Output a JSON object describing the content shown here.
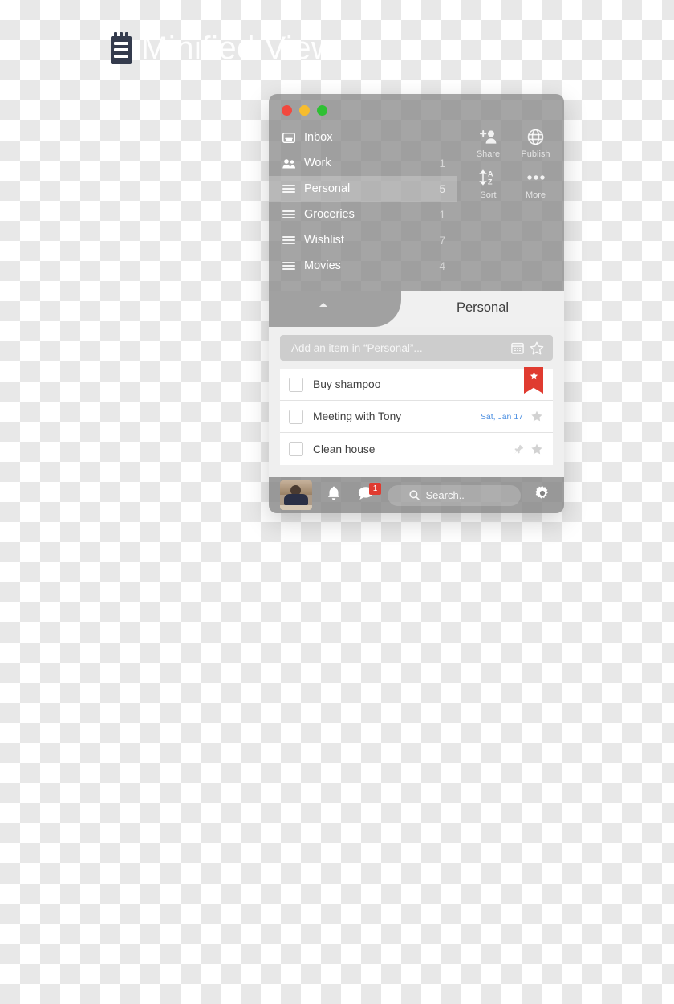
{
  "watermark": {
    "text": "Minified View",
    "logo_icon": "notepad-icon"
  },
  "window": {
    "traffic_lights": [
      {
        "name": "close",
        "color": "#f2483e"
      },
      {
        "name": "minimize",
        "color": "#f7bd2e"
      },
      {
        "name": "zoom",
        "color": "#2ec033"
      }
    ]
  },
  "sidebar": {
    "items": [
      {
        "label": "Inbox",
        "count": "",
        "icon": "inbox-icon",
        "selected": false
      },
      {
        "label": "Work",
        "count": "1",
        "icon": "people-icon",
        "selected": false
      },
      {
        "label": "Personal",
        "count": "5",
        "icon": "hamburger-icon",
        "selected": true
      },
      {
        "label": "Groceries",
        "count": "1",
        "icon": "hamburger-icon",
        "selected": false
      },
      {
        "label": "Wishlist",
        "count": "7",
        "icon": "hamburger-icon",
        "selected": false
      },
      {
        "label": "Movies",
        "count": "4",
        "icon": "hamburger-icon",
        "selected": false
      }
    ]
  },
  "actions": [
    {
      "label": "Share",
      "icon": "add-person-icon"
    },
    {
      "label": "Publish",
      "icon": "globe-icon"
    },
    {
      "label": "Sort",
      "icon": "sort-az-icon"
    },
    {
      "label": "More",
      "icon": "ellipsis-icon"
    }
  ],
  "tab": {
    "title": "Personal",
    "collapse_icon": "triangle-up-icon"
  },
  "add_item": {
    "placeholder": "Add an item in “Personal”...",
    "value": "",
    "calendar_icon": "calendar-icon",
    "star_icon": "star-outline-icon"
  },
  "tasks": [
    {
      "title": "Buy shampoo",
      "date": "",
      "checked": false,
      "flagged": true,
      "pinned": false,
      "flag_color": "#e03b30"
    },
    {
      "title": "Meeting with Tony",
      "date": "Sat, Jan 17",
      "checked": false,
      "flagged": false,
      "pinned": false,
      "date_color": "#4d90e2"
    },
    {
      "title": "Clean house",
      "date": "",
      "checked": false,
      "flagged": false,
      "pinned": true
    }
  ],
  "bottom_bar": {
    "avatar_name": "user-avatar",
    "bell_icon": "bell-icon",
    "chat_icon": "chat-bubble-icon",
    "chat_badge": "1",
    "search_placeholder": "Search..",
    "search_value": "",
    "search_icon": "search-icon",
    "settings_icon": "gear-icon"
  },
  "colors": {
    "accent_red": "#e03b30",
    "accent_blue": "#4d90e2",
    "panel_gray": "rgba(130,130,130,0.72)",
    "content_bg": "#efefef"
  }
}
